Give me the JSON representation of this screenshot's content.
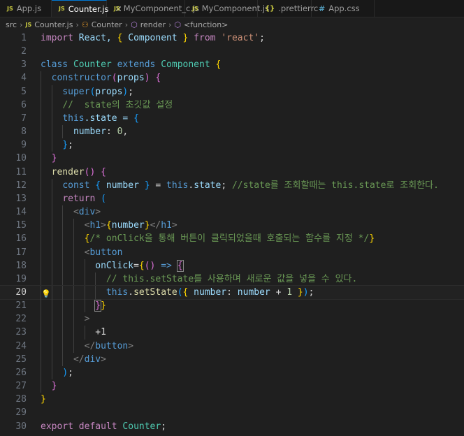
{
  "tabs": [
    {
      "label": "App.js",
      "icon": "JS"
    },
    {
      "label": "Counter.js",
      "icon": "JS",
      "active": true,
      "close": "✕"
    },
    {
      "label": "MyComponent_c.js",
      "icon": "JS"
    },
    {
      "label": "MyComponent.js",
      "icon": "JS"
    },
    {
      "label": ".prettierrc",
      "icon": "{}"
    },
    {
      "label": "App.css",
      "icon": "#"
    }
  ],
  "breadcrumb": {
    "folder": "src",
    "file": "Counter.js",
    "file_icon": "JS",
    "class": "Counter",
    "method": "render",
    "fn": "<function>"
  },
  "lines": [
    [
      [
        "import",
        "c"
      ],
      [
        " React, ",
        "v"
      ],
      [
        "{",
        "b1"
      ],
      [
        " Component ",
        "v"
      ],
      [
        "}",
        "b1"
      ],
      [
        " from ",
        "c"
      ],
      [
        "'react'",
        "s"
      ],
      [
        ";",
        "p"
      ]
    ],
    [],
    [
      [
        "class ",
        "k"
      ],
      [
        "Counter ",
        "t"
      ],
      [
        "extends ",
        "k"
      ],
      [
        "Component ",
        "t"
      ],
      [
        "{",
        "b1"
      ]
    ],
    [
      [
        "  "
      ],
      [
        "constructor",
        "k"
      ],
      [
        "(",
        "b2"
      ],
      [
        "props",
        "v"
      ],
      [
        ")",
        "b2"
      ],
      [
        " ",
        "p"
      ],
      [
        "{",
        "b2"
      ]
    ],
    [
      [
        "    "
      ],
      [
        "super",
        "k"
      ],
      [
        "(",
        "b3"
      ],
      [
        "props",
        "v"
      ],
      [
        ")",
        "b3"
      ],
      [
        ";",
        "p"
      ]
    ],
    [
      [
        "    "
      ],
      [
        "//  state의 초깃값 설정",
        "m"
      ]
    ],
    [
      [
        "    "
      ],
      [
        "this",
        "k"
      ],
      [
        ".state = ",
        "v"
      ],
      [
        "{",
        "b3"
      ]
    ],
    [
      [
        "      "
      ],
      [
        "number",
        "v"
      ],
      [
        ": ",
        "p"
      ],
      [
        "0",
        "n"
      ],
      [
        ",",
        "p"
      ]
    ],
    [
      [
        "    "
      ],
      [
        "}",
        "b3"
      ],
      [
        ";",
        "p"
      ]
    ],
    [
      [
        "  "
      ],
      [
        "}",
        "b2"
      ]
    ],
    [
      [
        "  "
      ],
      [
        "render",
        "f"
      ],
      [
        "()",
        "b2"
      ],
      [
        " ",
        "p"
      ],
      [
        "{",
        "b2"
      ]
    ],
    [
      [
        "    "
      ],
      [
        "const ",
        "k"
      ],
      [
        "{",
        "b3"
      ],
      [
        " number ",
        "v"
      ],
      [
        "}",
        "b3"
      ],
      [
        " = ",
        "p"
      ],
      [
        "this",
        "k"
      ],
      [
        ".",
        "p"
      ],
      [
        "state",
        "v"
      ],
      [
        "; ",
        "p"
      ],
      [
        "//state를 조회할때는 this.state로 조회한다.",
        "m"
      ]
    ],
    [
      [
        "    "
      ],
      [
        "return ",
        "c"
      ],
      [
        "(",
        "b3"
      ]
    ],
    [
      [
        "      "
      ],
      [
        "<",
        "g"
      ],
      [
        "div",
        "k"
      ],
      [
        ">",
        "g"
      ]
    ],
    [
      [
        "        "
      ],
      [
        "<",
        "g"
      ],
      [
        "h1",
        "k"
      ],
      [
        ">",
        "g"
      ],
      [
        "{",
        "b1"
      ],
      [
        "number",
        "v"
      ],
      [
        "}",
        "b1"
      ],
      [
        "</",
        "g"
      ],
      [
        "h1",
        "k"
      ],
      [
        ">",
        "g"
      ]
    ],
    [
      [
        "        "
      ],
      [
        "{",
        "b1"
      ],
      [
        "/* onClick을 통해 버튼이 클릭되었을때 호출되는 함수를 지정 */",
        "m"
      ],
      [
        "}",
        "b1"
      ]
    ],
    [
      [
        "        "
      ],
      [
        "<",
        "g"
      ],
      [
        "button",
        "k"
      ]
    ],
    [
      [
        "          "
      ],
      [
        "onClick",
        "v"
      ],
      [
        "=",
        "p"
      ],
      [
        "{",
        "b1"
      ],
      [
        "()",
        "b2"
      ],
      [
        " => ",
        "k"
      ],
      [
        "{",
        "b2 bm"
      ]
    ],
    [
      [
        "            "
      ],
      [
        "// this.setState를 사용하며 새로운 값을 넣을 수 있다.",
        "m"
      ]
    ],
    [
      [
        "            "
      ],
      [
        "this",
        "k"
      ],
      [
        ".",
        "p"
      ],
      [
        "setState",
        "f"
      ],
      [
        "(",
        "b3"
      ],
      [
        "{",
        "b1"
      ],
      [
        " number",
        "v"
      ],
      [
        ": ",
        "p"
      ],
      [
        "number",
        "v"
      ],
      [
        " + ",
        "p"
      ],
      [
        "1",
        "n"
      ],
      [
        " ",
        "p"
      ],
      [
        "}",
        "b1"
      ],
      [
        ")",
        "b3"
      ],
      [
        ";",
        "p"
      ]
    ],
    [
      [
        "          "
      ],
      [
        "}",
        "b2 bm"
      ],
      [
        "}",
        "b1"
      ]
    ],
    [
      [
        "        "
      ],
      [
        ">",
        "g"
      ]
    ],
    [
      [
        "          "
      ],
      [
        "+1",
        "p"
      ]
    ],
    [
      [
        "        "
      ],
      [
        "</",
        "g"
      ],
      [
        "button",
        "k"
      ],
      [
        ">",
        "g"
      ]
    ],
    [
      [
        "      "
      ],
      [
        "</",
        "g"
      ],
      [
        "div",
        "k"
      ],
      [
        ">",
        "g"
      ]
    ],
    [
      [
        "    "
      ],
      [
        ")",
        "b3"
      ],
      [
        ";",
        "p"
      ]
    ],
    [
      [
        "  "
      ],
      [
        "}",
        "b2"
      ]
    ],
    [
      [
        "}",
        "b1"
      ]
    ],
    [],
    [
      [
        "export ",
        "c"
      ],
      [
        "default ",
        "c"
      ],
      [
        "Counter",
        "t"
      ],
      [
        ";",
        "p"
      ]
    ]
  ],
  "current_line": 20,
  "colors": {
    "accent": "#0078d4",
    "keyword": "#569cd6",
    "comment": "#6a9955"
  }
}
